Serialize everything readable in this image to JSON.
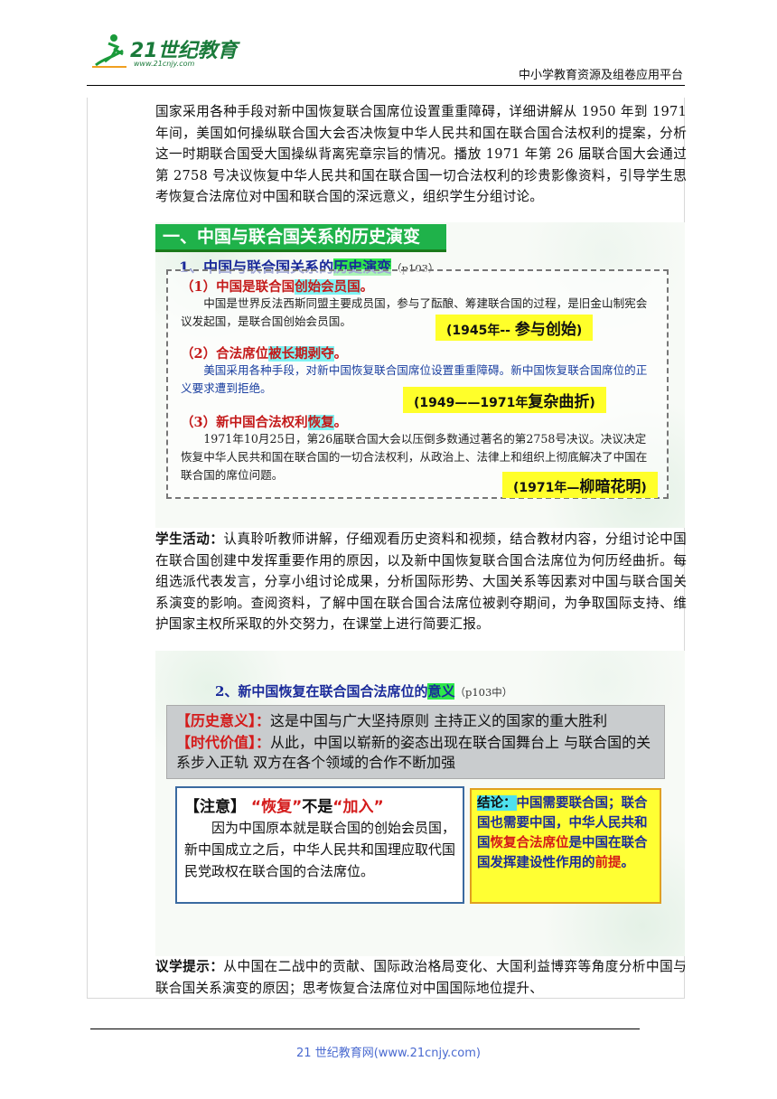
{
  "header": {
    "logo_text": "21世纪教育",
    "logo_url": "www.21cnjy.com",
    "right_text": "中小学教育资源及组卷应用平台"
  },
  "para1": {
    "text": "国家采用各种手段对新中国恢复联合国席位设置重重障碍，详细讲解从 1950 年到 1971 年间，美国如何操纵联合国大会否决恢复中华人民共和国在联合国合法权利的提案，分析这一时期联合国受大国操纵背离宪章宗旨的情况。播放 1971 年第 26 届联合国大会通过第 2758 号决议恢复中华人民共和国在联合国一切合法权利的珍贵影像资料，引导学生思考恢复合法席位对中国和联合国的深远意义，组织学生分组讨论。"
  },
  "slide1": {
    "header": "一、中国与联合国关系的历史演变",
    "subtitle_pre": "1、中国与联合国关系的",
    "subtitle_hl": "历史演变",
    "subtitle_ref": "（p103）",
    "items": [
      {
        "title_pre": "（1）中国是联合国",
        "title_hl": "创始会员国",
        "title_post": "。",
        "text": "中国是世界反法西斯同盟主要成员国，参与了酝酿、筹建联合国的过程，是旧金山制宪会议发起国，是联合国创始会员国。",
        "tag_pre": "(1945年-- ",
        "tag_big": "参与创始",
        "tag_post": ")"
      },
      {
        "title_pre": "（2）合法席位",
        "title_hl": "被长期剥夺",
        "title_post": "。",
        "text": "美国采用各种手段，对新中国恢复联合国席位设置重重障碍。新中国恢复联合国席位的正义要求遭到拒绝。",
        "tag_pre": "(1949——1971年",
        "tag_big": "复杂曲折",
        "tag_post": ")"
      },
      {
        "title_pre": "（3）新中国合法权利",
        "title_hl": "恢复",
        "title_post": "。",
        "text": "1971年10月25日，第26届联合国大会以压倒多数通过著名的第2758号决议。决议决定恢复中华人民共和国在联合国的一切合法权利，从政治上、法律上和组织上彻底解决了中国在联合国的席位问题。",
        "tag_pre": "(1971年—",
        "tag_big": "柳暗花明",
        "tag_post": ")"
      }
    ]
  },
  "para2": {
    "label": "学生活动：",
    "text": "认真聆听教师讲解，仔细观看历史资料和视频，结合教材内容，分组讨论中国在联合国创建中发挥重要作用的原因，以及新中国恢复联合国合法席位为何历经曲折。每组选派代表发言，分享小组讨论成果，分析国际形势、大国关系等因素对中国与联合国关系演变的影响。查阅资料，了解中国在联合国合法席位被剥夺期间，为争取国际支持、维护国家主权所采取的外交努力，在课堂上进行简要汇报。"
  },
  "slide2": {
    "subtitle_pre": "2、新中国恢复在联合国合法席位的",
    "subtitle_hl": "意义",
    "subtitle_ref": "（p103中）",
    "line1_label": "【历史意义】：",
    "line1_text": "这是中国与广大坚持原则 主持正义的国家的重大胜利",
    "line2_label": "【时代价值】：",
    "line2_text": "从此，中国以崭新的姿态出现在联合国舞台上 与联合国的关系步入正轨 双方在各个领域的合作不断加强",
    "note_head_pre": "【注意】 ",
    "note_head_a": "“恢复”",
    "note_head_mid": "不是",
    "note_head_b": "“加入”",
    "note_body": "因为中国原本就是联合国的创始会员国，新中国成立之后，中华人民共和国理应取代国民党政权在联合国的合法席位。",
    "concl_label": "结论：",
    "concl_1": "中国需要联合国；联合国也需要中国，中华人民共和国",
    "concl_red": "恢复合法席位",
    "concl_2": "是中国在联合国发挥建设性作用的",
    "concl_red2": "前提",
    "concl_3": "。"
  },
  "para3": {
    "label": "议学提示：",
    "text": "从中国在二战中的贡献、国际政治格局变化、大国利益博弈等角度分析中国与联合国关系演变的原因；思考恢复合法席位对中国国际地位提升、"
  },
  "footer": {
    "text": "21 世纪教育网(www.21cnjy.com)"
  }
}
